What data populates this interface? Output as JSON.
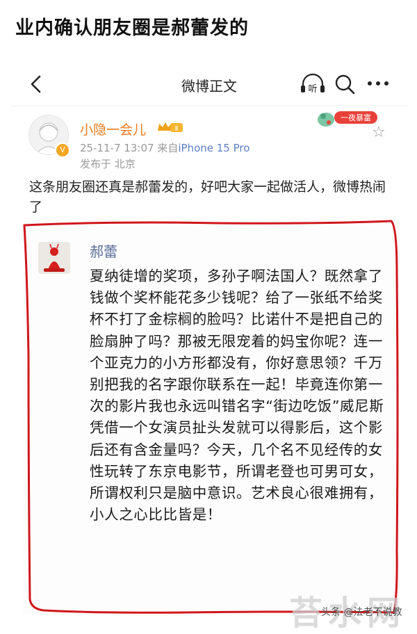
{
  "headline": "业内确认朋友圈是郝蕾发的",
  "nav": {
    "title": "微博正文",
    "listen_label": "听"
  },
  "post": {
    "username": "小隐一会儿",
    "level_badge": "Ⅱ",
    "date": "25-11-7 13:07",
    "source_prefix": "来自",
    "device": "iPhone 15 Pro",
    "location": "发布于 北京",
    "sticker_text": "一夜暴富",
    "text": "这条朋友圈还真是郝蕾发的，好吧大家一起做活人，微博热闹了"
  },
  "moment": {
    "name": "郝蕾",
    "text": "夏纳徒增的奖项，多孙子啊法国人？既然拿了钱做个奖杯能花多少钱呢？给了一张纸不给奖杯不打了金棕榈的脸吗？比诺什不是把自己的脸扇肿了吗？那被无限宠着的妈宝你呢？连一个亚克力的小方形都没有，你好意思领？千万别把我的名字跟你联系在一起！毕竟连你第一次的影片我也永远叫错名字“街边吃饭”威尼斯凭借一个女演员扯头发就可以得影后，这个影后还有含金量吗？今天，几个名不见经传的女性玩转了东京电影节，所谓老登也可男可女，所谓权利只是脑中意识。艺术良心很难拥有，小人之心比比皆是！"
  },
  "watermark": {
    "big": "苔水网",
    "small": "头条 @法老不说教"
  },
  "colors": {
    "username": "#ee7a1c",
    "moment_name": "#576b95",
    "device_link": "#5b7ec4",
    "annotation_red": "#d0161b"
  }
}
